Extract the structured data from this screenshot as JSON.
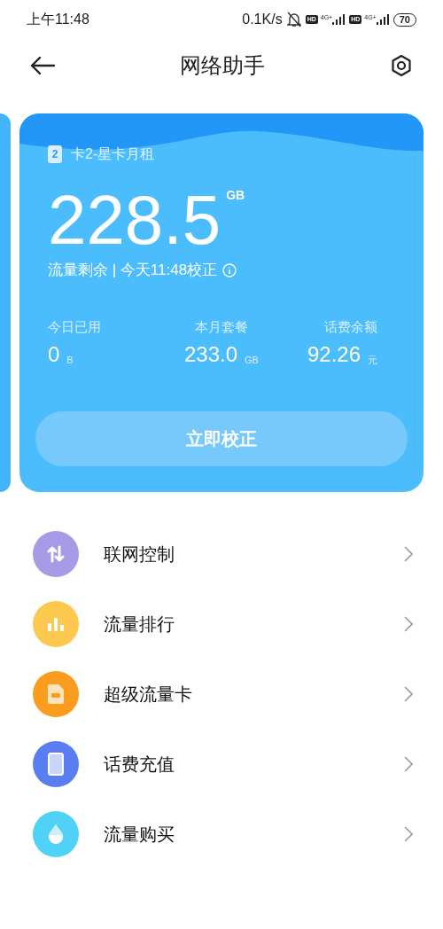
{
  "status_bar": {
    "time": "上午11:48",
    "speed": "0.1K/s",
    "sims": [
      {
        "hd": "HD",
        "network": "4G+"
      },
      {
        "hd": "HD",
        "network": "4G+"
      }
    ],
    "battery": "70"
  },
  "header": {
    "title": "网络助手"
  },
  "card": {
    "sim_number": "2",
    "sim_name": "卡2-星卡月租",
    "remaining": "228.5",
    "remaining_unit": "GB",
    "caption": "流量剩余 | 今天11:48校正",
    "stats": [
      {
        "label": "今日已用",
        "value": "0",
        "unit": "B"
      },
      {
        "label": "本月套餐",
        "value": "233.0",
        "unit": "GB"
      },
      {
        "label": "话费余额",
        "value": "92.26",
        "unit": "元"
      }
    ],
    "button": "立即校正"
  },
  "menu": [
    {
      "label": "联网控制",
      "kind": "arrows",
      "color": "#a79be8"
    },
    {
      "label": "流量排行",
      "kind": "bars",
      "color": "#fcc84e"
    },
    {
      "label": "超级流量卡",
      "kind": "sim",
      "color": "#fa9c1e"
    },
    {
      "label": "话费充值",
      "kind": "phone",
      "color": "#5a7ef0"
    },
    {
      "label": "流量购买",
      "kind": "drop",
      "color": "#4fd2f6"
    }
  ]
}
